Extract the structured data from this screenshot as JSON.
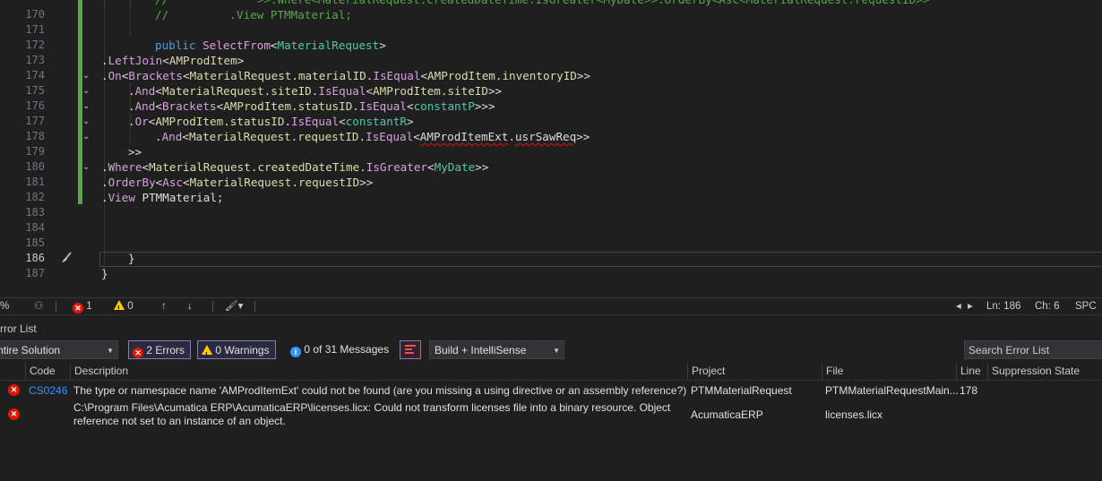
{
  "editor": {
    "lines": [
      {
        "num": "170",
        "active": false
      },
      {
        "num": "171",
        "active": false
      },
      {
        "num": "172",
        "active": false
      },
      {
        "num": "173",
        "active": false
      },
      {
        "num": "174",
        "active": false
      },
      {
        "num": "175",
        "active": false
      },
      {
        "num": "176",
        "active": false
      },
      {
        "num": "177",
        "active": false
      },
      {
        "num": "178",
        "active": false
      },
      {
        "num": "179",
        "active": false
      },
      {
        "num": "180",
        "active": false
      },
      {
        "num": "181",
        "active": false
      },
      {
        "num": "182",
        "active": false
      },
      {
        "num": "183",
        "active": false
      },
      {
        "num": "184",
        "active": false
      },
      {
        "num": "185",
        "active": false
      },
      {
        "num": "186",
        "active": true
      },
      {
        "num": "187",
        "active": false
      }
    ],
    "code": {
      "l170_comment": "//         .View PTMMaterial;",
      "l169_comment": "//             >>.Where<MaterialRequest.createdDateTime.IsGreater<MyDate>>.OrderBy<Asc<MaterialRequest.requestID>>",
      "l172_public": "public",
      "l172_selectfrom": "SelectFrom",
      "l172_lt": "<",
      "l172_mr": "MaterialRequest",
      "l172_gt": ">",
      "l173": [
        ".",
        "LeftJoin",
        "<",
        "AMProdItem",
        ">"
      ],
      "l174": [
        ".",
        "On",
        "<",
        "Brackets",
        "<",
        "MaterialRequest",
        ".",
        "materialID",
        ".",
        "IsEqual",
        "<",
        "AMProdItem",
        ".",
        "inventoryID",
        ">>"
      ],
      "l175": [
        ".",
        "And",
        "<",
        "MaterialRequest",
        ".",
        "siteID",
        ".",
        "IsEqual",
        "<",
        "AMProdItem",
        ".",
        "siteID",
        ">>"
      ],
      "l176": [
        ".",
        "And",
        "<",
        "Brackets",
        "<",
        "AMProdItem",
        ".",
        "statusID",
        ".",
        "IsEqual",
        "<",
        "constantP",
        ">>>"
      ],
      "l177": [
        ".",
        "Or",
        "<",
        "AMProdItem",
        ".",
        "statusID",
        ".",
        "IsEqual",
        "<",
        "constantR",
        ">"
      ],
      "l178": [
        ".",
        "And",
        "<",
        "MaterialRequest",
        ".",
        "requestID",
        ".",
        "IsEqual",
        "<",
        "AMProdItemExt",
        ".",
        "usrSawReq",
        ">>"
      ],
      "l179": ">>",
      "l180": [
        ".",
        "Where",
        "<",
        "MaterialRequest",
        ".",
        "createdDateTime",
        ".",
        "IsGreater",
        "<",
        "MyDate",
        ">>"
      ],
      "l181": [
        ".",
        "OrderBy",
        "<",
        "Asc",
        "<",
        "MaterialRequest",
        ".",
        "requestID",
        ">>"
      ],
      "l182": [
        ".",
        "View",
        " PTMMaterial;"
      ],
      "l186": "}",
      "l187": "}"
    }
  },
  "statusbar": {
    "zoom": "%",
    "errors": "1",
    "warnings": "0",
    "ln": "Ln: 186",
    "ch": "Ch: 6",
    "encoding": "SPC"
  },
  "errorlist": {
    "title": "Error List",
    "scope": "Entire Solution",
    "errors_btn": "2 Errors",
    "warnings_btn": "0 Warnings",
    "messages": "0 of 31 Messages",
    "build_filter": "Build + IntelliSense",
    "search_placeholder": "Search Error List",
    "columns": [
      "Code",
      "Description",
      "Project",
      "File",
      "Line",
      "Suppression State"
    ],
    "rows": [
      {
        "code": "CS0246",
        "description": "The type or namespace name 'AMProdItemExt' could not be found (are you missing a using directive or an assembly reference?)",
        "project": "PTMMaterialRequest",
        "file": "PTMMaterialRequestMain...",
        "line": "178",
        "suppression": ""
      },
      {
        "code": "",
        "description1": "C:\\Program Files\\Acumatica ERP\\AcumaticaERP\\licenses.licx: Could not transform licenses file into a binary resource.  Object",
        "description2": "reference not set to an instance of an object.",
        "project": "AcumaticaERP",
        "file": "licenses.licx",
        "line": "",
        "suppression": ""
      }
    ]
  },
  "colors": {
    "keyword": "#569cd6",
    "type": "#4ec9b0",
    "method": "#dcdcaa",
    "error": "#e51400",
    "changebar": "#57a64a"
  }
}
